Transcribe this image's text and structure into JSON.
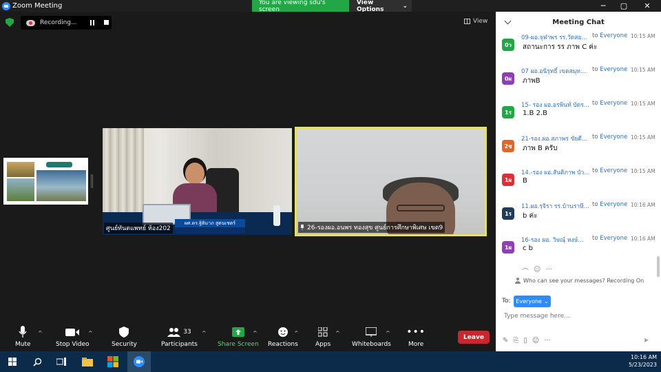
{
  "window": {
    "title": "Zoom Meeting"
  },
  "share_banner": {
    "viewing": "You are viewing sdu's screen",
    "options": "View Options"
  },
  "recording": {
    "label": "Recording..."
  },
  "view_button": {
    "label": "View"
  },
  "tiles": [
    {
      "name": "ศูนย์ทันตแพทย์ ห้อง202",
      "overlay_name": "ผศ.ดร.ฐิติมาภ สูตนเชตร์"
    },
    {
      "name": "26-รองผอ.อนพร ทองสุข ศูนย์การศึกษาพิเศษ เขต9"
    }
  ],
  "toolbar": {
    "mute": "Mute",
    "stop_video": "Stop Video",
    "security": "Security",
    "participants": "Participants",
    "participants_count": "33",
    "share_screen": "Share Screen",
    "reactions": "Reactions",
    "apps": "Apps",
    "whiteboards": "Whiteboards",
    "more": "More",
    "leave": "Leave"
  },
  "chat": {
    "title": "Meeting Chat",
    "messages": [
      {
        "sender": "09-ผอ.จุฬาพร รร.วัดสอ...",
        "to": "to",
        "recipient": "Everyone",
        "time": "10:15 AM",
        "avatar": "0ว",
        "avatar_color": "#23a645",
        "text": "สถานะการ รร ภาพ C ค่ะ"
      },
      {
        "sender": "07 ผอ.อนิรุทธิ์ เขตสมุท...",
        "to": "to",
        "recipient": "Everyone",
        "time": "10:15 AM",
        "avatar": "0ผ",
        "avatar_color": "#8e3fb5",
        "text": "ภาพB"
      },
      {
        "sender": "15- รอง ผอ.อรพินท์ บัตร...",
        "to": "to",
        "recipient": "Everyone",
        "time": "10:15 AM",
        "avatar": "1ร",
        "avatar_color": "#23a645",
        "text": "1.B 2.B"
      },
      {
        "sender": "21-รอง.ผอ.สภาพร ขัยดี...",
        "to": "to",
        "recipient": "Everyone",
        "time": "10:15 AM",
        "avatar": "2ช",
        "avatar_color": "#e0662a",
        "text": "ภาพ B ครับ"
      },
      {
        "sender": "14.-รอง ผอ.สันติภาพ บัว...",
        "to": "to",
        "recipient": "Everyone",
        "time": "10:15 AM",
        "avatar": "1ผ",
        "avatar_color": "#d9303a",
        "text": "B"
      },
      {
        "sender": "11.ผอ.รุจิรา รร.บ้านราษี...",
        "to": "to",
        "recipient": "Everyone",
        "time": "10:16 AM",
        "avatar": "1ร",
        "avatar_color": "#1f3d5a",
        "text": "b ค่ะ"
      },
      {
        "sender": "16-รอง ผอ. วิษณุ์ หงษ์...",
        "to": "to",
        "recipient": "Everyone",
        "time": "10:16 AM",
        "avatar": "1ผ",
        "avatar_color": "#8e3fb5",
        "text": "c b"
      }
    ],
    "privacy": "Who can see your messages? Recording On",
    "to_label": "To:",
    "to_value": "Everyone",
    "input_placeholder": "Type message here..."
  },
  "taskbar": {
    "time": "10:16 AM",
    "date": "5/23/2023"
  }
}
